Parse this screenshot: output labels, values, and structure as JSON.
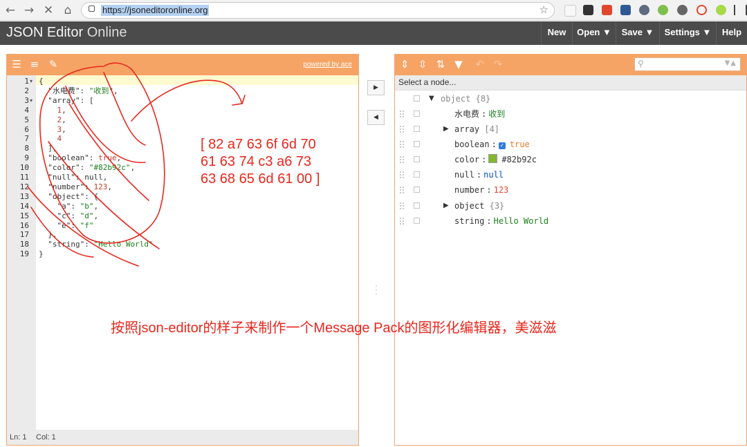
{
  "browser": {
    "url": "https://jsoneditoronline.org"
  },
  "app": {
    "title_bold": "JSON Editor",
    "title_light": "Online",
    "menu": [
      "New",
      "Open ▼",
      "Save ▼",
      "Settings ▼",
      "Help"
    ]
  },
  "code_panel": {
    "powered_by": "powered by ace",
    "line_numbers": [
      "1",
      "2",
      "3",
      "4",
      "5",
      "6",
      "7",
      "8",
      "9",
      "10",
      "11",
      "12",
      "13",
      "14",
      "15",
      "16",
      "17",
      "18",
      "19"
    ],
    "status_ln": "Ln: 1",
    "status_col": "Col: 1"
  },
  "tree_panel": {
    "nav_placeholder": "Select a node...",
    "root": {
      "name": "object",
      "count": "{8}"
    },
    "rows": [
      {
        "key": "水电费",
        "value": "收到"
      },
      {
        "key": "array",
        "value": "[4]"
      },
      {
        "key": "boolean",
        "value": "true"
      },
      {
        "key": "color",
        "value": "#82b92c"
      },
      {
        "key": "null",
        "value": "null"
      },
      {
        "key": "number",
        "value": "123"
      },
      {
        "key": "object",
        "value": "{3}"
      },
      {
        "key": "string",
        "value": "Hello World"
      }
    ]
  },
  "annotations": {
    "hex_lines": [
      "[ 82 a7 63 6f 6d 70",
      "61 63 74 c3 a6 73",
      "63 68 65 6d 61 00 ]"
    ],
    "caption": "按照json-editor的样子来制作一个Message Pack的图形化编辑器，美滋滋"
  },
  "colors": {
    "accent": "#f6a465",
    "header": "#4b4b4b",
    "annotation": "#e8271d",
    "swatch": "#82b92c"
  }
}
